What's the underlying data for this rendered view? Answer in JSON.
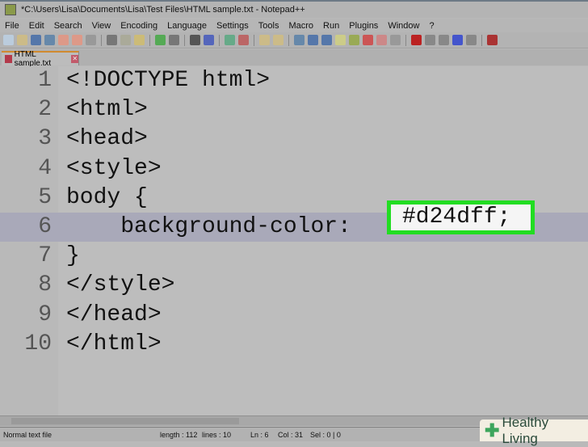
{
  "window": {
    "title": "*C:\\Users\\Lisa\\Documents\\Lisa\\Test Files\\HTML sample.txt - Notepad++"
  },
  "menu": [
    "File",
    "Edit",
    "Search",
    "View",
    "Encoding",
    "Language",
    "Settings",
    "Tools",
    "Macro",
    "Run",
    "Plugins",
    "Window",
    "?"
  ],
  "tab": {
    "label": "HTML sample.txt",
    "close": "✕"
  },
  "editor": {
    "current_line": 6,
    "lines": [
      {
        "n": "1",
        "text": "<!DOCTYPE html>"
      },
      {
        "n": "2",
        "text": "<html>"
      },
      {
        "n": "3",
        "text": "<head>"
      },
      {
        "n": "4",
        "text": "<style>"
      },
      {
        "n": "5",
        "text": "body {"
      },
      {
        "n": "6",
        "text": "    background-color: "
      },
      {
        "n": "7",
        "text": "}"
      },
      {
        "n": "8",
        "text": "</style>"
      },
      {
        "n": "9",
        "text": "</head>"
      },
      {
        "n": "10",
        "text": "</html>"
      }
    ],
    "highlight": {
      "text": "#d24dff;",
      "border_color": "#22dd22"
    }
  },
  "status": {
    "type": "Normal text file",
    "length": "length : 112",
    "lines": "lines : 10",
    "ln": "Ln : 6",
    "col": "Col : 31",
    "sel": "Sel : 0 | 0"
  },
  "watermark": "Healthy Living"
}
